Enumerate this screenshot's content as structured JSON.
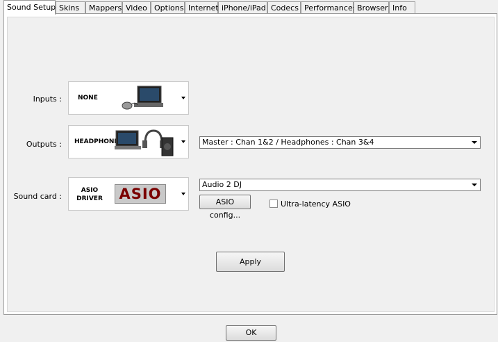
{
  "tabs": [
    {
      "label": "Sound Setup",
      "active": true
    },
    {
      "label": "Skins"
    },
    {
      "label": "Mappers"
    },
    {
      "label": "Video"
    },
    {
      "label": "Options"
    },
    {
      "label": "Internet"
    },
    {
      "label": "iPhone/iPad"
    },
    {
      "label": "Codecs"
    },
    {
      "label": "Performances"
    },
    {
      "label": "Browser"
    },
    {
      "label": "Info"
    }
  ],
  "inputs": {
    "label": "Inputs :",
    "selected": "NONE"
  },
  "outputs": {
    "label": "Outputs :",
    "selected": "HEADPHONES",
    "channel_mapping": "Master : Chan 1&2 / Headphones : Chan 3&4"
  },
  "sound_card": {
    "label": "Sound card :",
    "driver_line1": "ASIO",
    "driver_line2": "DRIVER",
    "logo_text": "ASIO",
    "device": "Audio 2 DJ",
    "config_button": "ASIO config...",
    "ultra_latency_label": "Ultra-latency ASIO",
    "ultra_latency_checked": false
  },
  "apply_button": "Apply",
  "ok_button": "OK"
}
